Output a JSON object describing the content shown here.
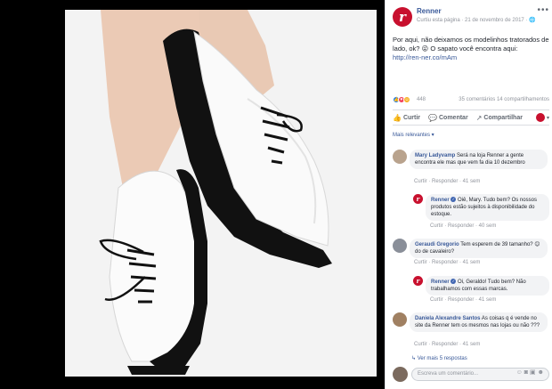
{
  "post": {
    "page_name": "Renner",
    "meta": "Curtiu esta página · 21 de novembro de 2017 · 🌐",
    "text": "Por aqui, não deixamos os modelinhos tratorados de lado, ok? 😜 O sapato você encontra aqui:",
    "link": "http://ren-ner.co/mAm",
    "reaction_count": "448",
    "stats": "35 comentários  14 compartilhamentos"
  },
  "actions": {
    "like": "Curtir",
    "comment": "Comentar",
    "share": "Compartilhar"
  },
  "sort_label": "Mais relevantes ▾",
  "comments": [
    {
      "name": "Mary Ladyvamp",
      "text": "Será na loja Renner a gente encontra ele mas que vem fa dia 10 dezembro",
      "actions": "Curtir · Responder · 41 sem"
    },
    {
      "name": "Renner",
      "text": "Oiê, Mary. Tudo bem? Os nossos produtos estão sujeitos à disponibilidade do estoque.",
      "actions": "Curtir · Responder · 40 sem"
    },
    {
      "name": "Geraudi Gregorio",
      "text": "Tem esperem de 39 tamanho? 😊 do de cavaleiro?",
      "actions": "Curtir · Responder · 41 sem"
    },
    {
      "name": "Renner",
      "text": "Oi, Geraldo! Tudo bem? Não trabalhamos com essas marcas.",
      "actions": "Curtir · Responder · 41 sem"
    },
    {
      "name": "Daniela Alexandre Santos",
      "text": "As coisas q é vende no site da Renner tem os mesmos nas lojas ou não ???",
      "actions": "Curtir · Responder · 41 sem"
    }
  ],
  "view_more": "↳ Ver mais 5 respostas",
  "compose": {
    "placeholder": "Escreva um comentário..."
  },
  "colors": {
    "brand": "#c8102e",
    "link": "#385898",
    "facebook_blue": "#4267b2"
  }
}
